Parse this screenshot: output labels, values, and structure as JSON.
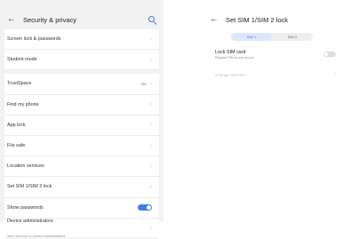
{
  "left_screen": {
    "title": "Security & privacy",
    "rows": [
      {
        "label": "Screen lock & passwords"
      },
      {
        "label": "Student mode"
      },
      {
        "label": "TrustSpace",
        "value": "On"
      },
      {
        "label": "Find my phone"
      },
      {
        "label": "App lock"
      },
      {
        "label": "File safe"
      },
      {
        "label": "Location services"
      },
      {
        "label": "Set SIM 1/SIM 2 lock"
      },
      {
        "label": "Show passwords",
        "toggle": "on"
      },
      {
        "label": "Device administrators",
        "sub": "View and turn on device administrators"
      }
    ]
  },
  "right_screen": {
    "title": "Set SIM 1/SIM 2 lock",
    "tabs": [
      "SIM 1",
      "SIM 2"
    ],
    "active_tab": "SIM 1",
    "lock_sim": {
      "label": "Lock SIM card",
      "sub": "Require PIN to use phone",
      "toggle": "off"
    },
    "change_pin": {
      "label": "Change SIM PIN"
    }
  },
  "colors": {
    "accent": "#3f7ce8",
    "list_bg": "#f2f2f2",
    "row_bg": "#ffffff"
  }
}
